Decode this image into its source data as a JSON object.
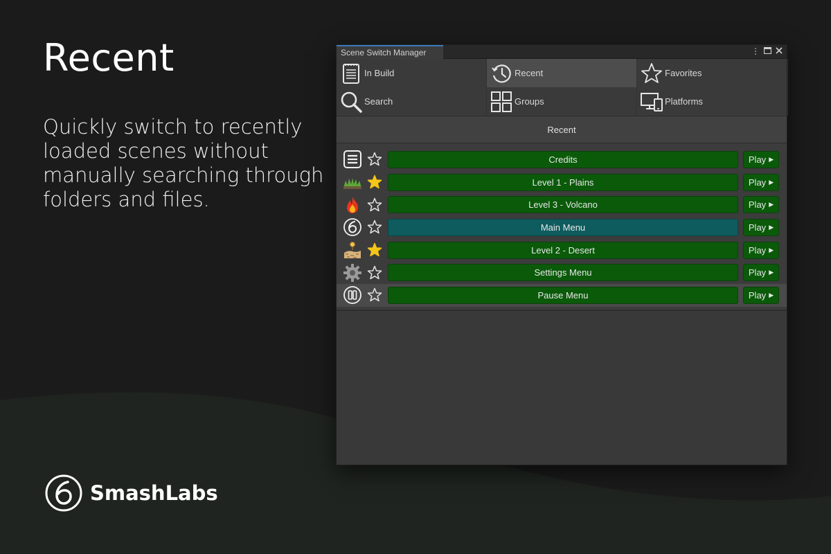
{
  "hero": {
    "title": "Recent",
    "description": "Quickly switch to recently loaded scenes without manually searching through folders and files."
  },
  "brand": {
    "name": "SmashLabs"
  },
  "window": {
    "title": "Scene Switch Manager",
    "controls": [
      "more-icon",
      "maximize-icon",
      "close-icon"
    ],
    "nav": [
      {
        "label": "In Build",
        "icon": "clipboard-list-icon",
        "active": false
      },
      {
        "label": "Recent",
        "icon": "history-icon",
        "active": true
      },
      {
        "label": "Favorites",
        "icon": "star-outline-icon",
        "active": false
      },
      {
        "label": "Search",
        "icon": "search-icon",
        "active": false
      },
      {
        "label": "Groups",
        "icon": "grid-icon",
        "active": false
      },
      {
        "label": "Platforms",
        "icon": "devices-icon",
        "active": false
      }
    ],
    "section_title": "Recent",
    "scenes": [
      {
        "name": "Credits",
        "icon": "list-icon",
        "favorite": false,
        "current": false,
        "play": "Play"
      },
      {
        "name": "Level 1 - Plains",
        "icon": "grass-icon",
        "favorite": true,
        "current": false,
        "play": "Play"
      },
      {
        "name": "Level 3 - Volcano",
        "icon": "fire-icon",
        "favorite": false,
        "current": false,
        "play": "Play"
      },
      {
        "name": "Main Menu",
        "icon": "smashlabs-logo-icon",
        "favorite": false,
        "current": true,
        "play": "Play"
      },
      {
        "name": "Level 2 - Desert",
        "icon": "desert-icon",
        "favorite": true,
        "current": false,
        "play": "Play"
      },
      {
        "name": "Settings Menu",
        "icon": "gear-icon",
        "favorite": false,
        "current": false,
        "play": "Play"
      },
      {
        "name": "Pause Menu",
        "icon": "pause-icon",
        "favorite": false,
        "current": false,
        "play": "Play"
      }
    ]
  },
  "colors": {
    "background": "#1b1b1b",
    "wave": "#1f2420",
    "scene_button": "#0a5a0a",
    "current_scene_button": "#0f5c5f",
    "favorite_star": "#f5c518",
    "title_tab_accent": "#3a79bb"
  }
}
